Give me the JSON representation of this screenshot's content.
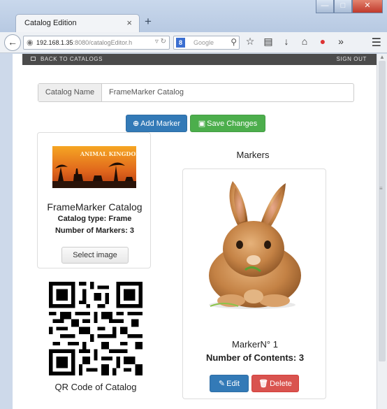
{
  "browser": {
    "tab_title": "Catalog Edition",
    "tab_close": "×",
    "new_tab": "+",
    "url_host": "192.168.1.35",
    "url_rest": ":8080/catalogEditor.h",
    "search_placeholder": "Google",
    "search_engine_letter": "8"
  },
  "navbar": {
    "back_label": "BACK TO CATALOGS",
    "signout_label": "SIGN OUT"
  },
  "form": {
    "catalog_name_label": "Catalog Name",
    "catalog_name_value": "FrameMarker Catalog"
  },
  "actions": {
    "add_marker_label": "Add Marker",
    "save_changes_label": "Save Changes"
  },
  "catalog": {
    "image_text": "ANIMAL KINGDOM",
    "name": "FrameMarker Catalog",
    "type_line": "Catalog type: Frame",
    "markers_line": "Number of Markers: 3",
    "select_image_label": "Select image"
  },
  "qr": {
    "caption": "QR Code of Catalog"
  },
  "markers": {
    "title": "Markers",
    "items": [
      {
        "name": "MarkerN° 1",
        "contents_line": "Number of Contents: 3",
        "edit_label": "Edit",
        "delete_label": "Delete"
      }
    ]
  },
  "colors": {
    "primary": "#337ab7",
    "success": "#4cae4c",
    "danger": "#d9534f",
    "navbar": "#4b4b4b"
  }
}
